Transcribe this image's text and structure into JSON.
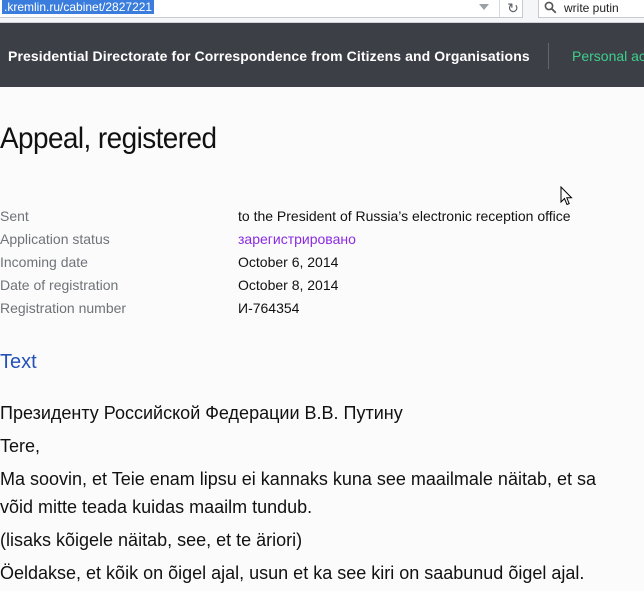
{
  "browser": {
    "url": ".kremlin.ru/cabinet/2827221",
    "search_value": "write putin"
  },
  "header": {
    "title": "Presidential Directorate for Correspondence from Citizens and Organisations",
    "personal_link": "Personal ac"
  },
  "page": {
    "title": "Appeal, registered"
  },
  "details": [
    {
      "label": "Sent",
      "value": "to the President of Russia’s electronic reception office"
    },
    {
      "label": "Application status",
      "value": "зарегистрировано"
    },
    {
      "label": "Incoming date",
      "value": "October 6, 2014"
    },
    {
      "label": "Date of registration",
      "value": "October 8, 2014"
    },
    {
      "label": "Registration number",
      "value": "И-764354"
    }
  ],
  "text_section": {
    "heading": "Text",
    "lines": [
      "Президенту Российской Федерации В.В. Путину",
      "Tere,",
      "Ma soovin, et Teie enam lipsu ei kannaks kuna see maailmale näitab, et sa",
      "võid mitte teada kuidas maailm tundub.",
      "(lisaks kõigele näitab, see, et te äriori)",
      "Öeldakse, et kõik on õigel ajal, usun et ka see kiri on saabunud õigel ajal."
    ]
  },
  "colors": {
    "header_bg": "#3c3f45",
    "personal_link": "#3ecf8e",
    "status": "#8a2be2",
    "section_heading": "#2452b8"
  }
}
